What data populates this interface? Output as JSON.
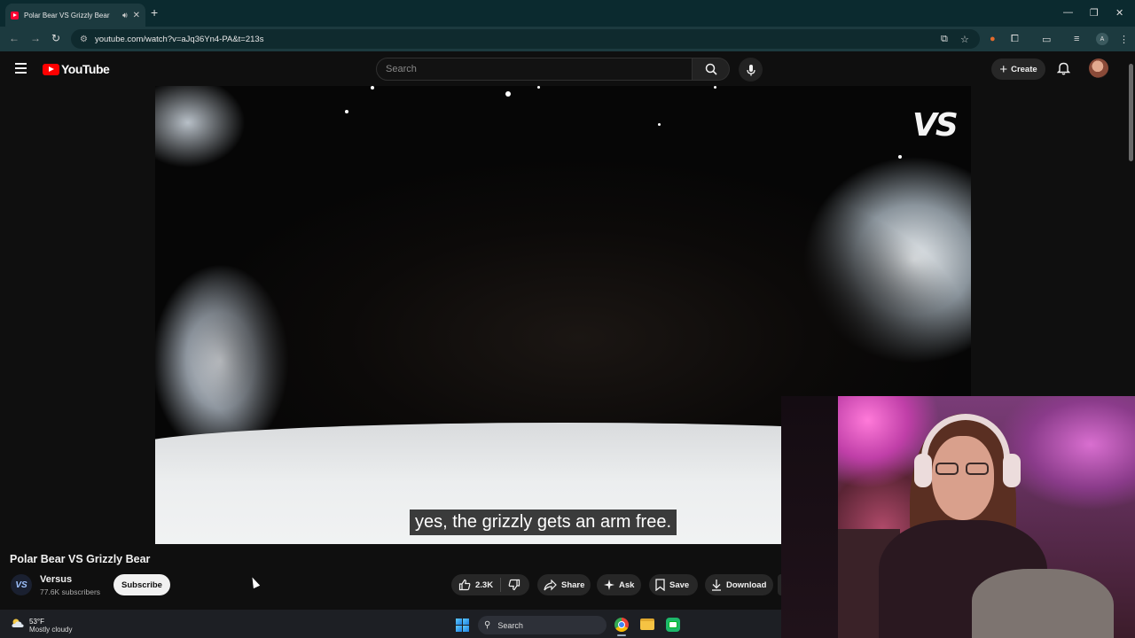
{
  "browser": {
    "tab_title": "Polar Bear VS Grizzly Bear",
    "url": "youtube.com/watch?v=aJq36Yn4-PA&t=213s",
    "profile_initial": "A"
  },
  "youtube": {
    "logo_text": "YouTube",
    "search_placeholder": "Search",
    "create_label": "Create"
  },
  "video": {
    "overlay_logo": "VS",
    "caption": "yes, the grizzly gets an arm free.",
    "title": "Polar Bear VS Grizzly Bear"
  },
  "channel": {
    "name": "Versus",
    "subscribers": "77.6K subscribers",
    "subscribe_label": "Subscribe"
  },
  "actions": {
    "likes": "2.3K",
    "share": "Share",
    "ask": "Ask",
    "save": "Save",
    "download": "Download"
  },
  "taskbar": {
    "temperature": "53°F",
    "weather": "Mostly cloudy",
    "search_label": "Search"
  },
  "colors": {
    "youtube_red": "#ff0000",
    "chrome_frame": "#0b2a2f",
    "page_bg": "#0f0f0f"
  }
}
